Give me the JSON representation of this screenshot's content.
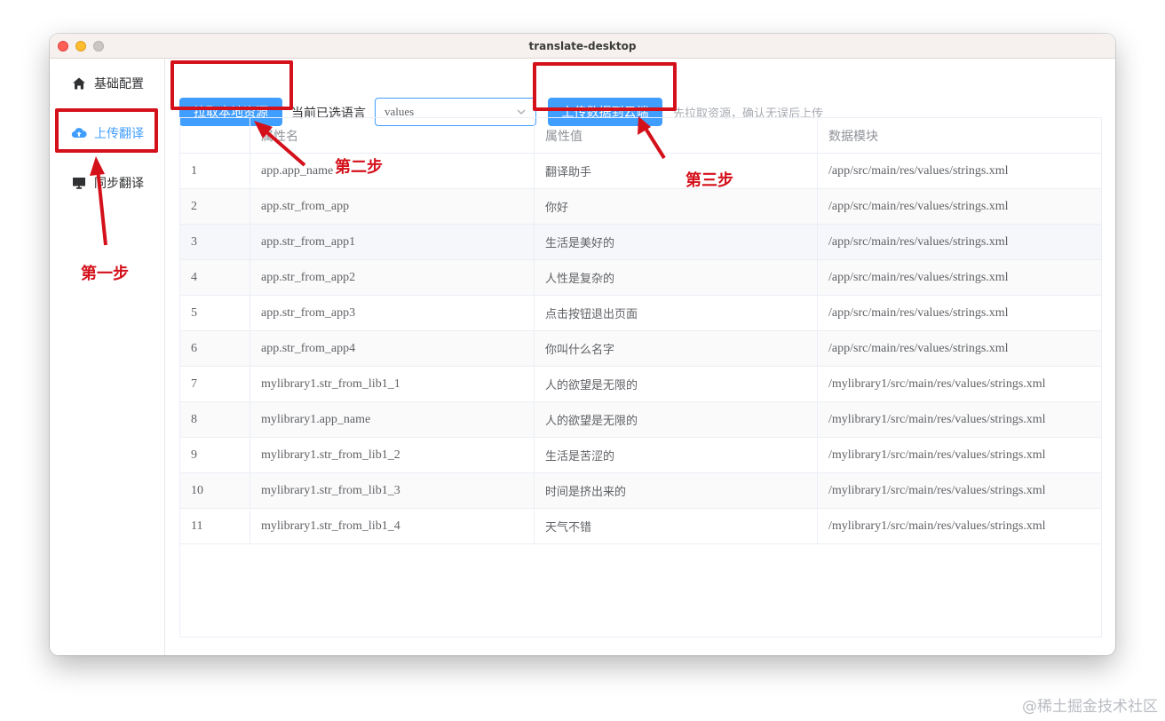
{
  "window": {
    "title": "translate-desktop"
  },
  "sidebar": {
    "items": [
      {
        "label": "基础配置",
        "icon": "home-icon",
        "active": false
      },
      {
        "label": "上传翻译",
        "icon": "cloud-upload-icon",
        "active": true
      },
      {
        "label": "同步翻译",
        "icon": "monitor-icon",
        "active": false
      }
    ]
  },
  "toolbar": {
    "pull_button": "拉取本地资源",
    "language_label": "当前已选语言",
    "language_value": "values",
    "upload_button": "上传数据到云端",
    "hint": "先拉取资源，确认无误后上传"
  },
  "table": {
    "headers": [
      "",
      "属性名",
      "属性值",
      "数据模块"
    ],
    "rows": [
      [
        "1",
        "app.app_name",
        "翻译助手",
        "/app/src/main/res/values/strings.xml"
      ],
      [
        "2",
        "app.str_from_app",
        "你好",
        "/app/src/main/res/values/strings.xml"
      ],
      [
        "3",
        "app.str_from_app1",
        "生活是美好的",
        "/app/src/main/res/values/strings.xml"
      ],
      [
        "4",
        "app.str_from_app2",
        "人性是复杂的",
        "/app/src/main/res/values/strings.xml"
      ],
      [
        "5",
        "app.str_from_app3",
        "点击按钮退出页面",
        "/app/src/main/res/values/strings.xml"
      ],
      [
        "6",
        "app.str_from_app4",
        "你叫什么名字",
        "/app/src/main/res/values/strings.xml"
      ],
      [
        "7",
        "mylibrary1.str_from_lib1_1",
        "人的欲望是无限的",
        "/mylibrary1/src/main/res/values/strings.xml"
      ],
      [
        "8",
        "mylibrary1.app_name",
        "人的欲望是无限的",
        "/mylibrary1/src/main/res/values/strings.xml"
      ],
      [
        "9",
        "mylibrary1.str_from_lib1_2",
        "生活是苦涩的",
        "/mylibrary1/src/main/res/values/strings.xml"
      ],
      [
        "10",
        "mylibrary1.str_from_lib1_3",
        "时间是挤出来的",
        "/mylibrary1/src/main/res/values/strings.xml"
      ],
      [
        "11",
        "mylibrary1.str_from_lib1_4",
        "天气不错",
        "/mylibrary1/src/main/res/values/strings.xml"
      ]
    ]
  },
  "annotations": {
    "step1": "第一步",
    "step2": "第二步",
    "step3": "第三步",
    "color": "#d4111b"
  },
  "watermark": "@稀土掘金技术社区",
  "colors": {
    "primary": "#409eff",
    "annotation": "#d4111b"
  }
}
